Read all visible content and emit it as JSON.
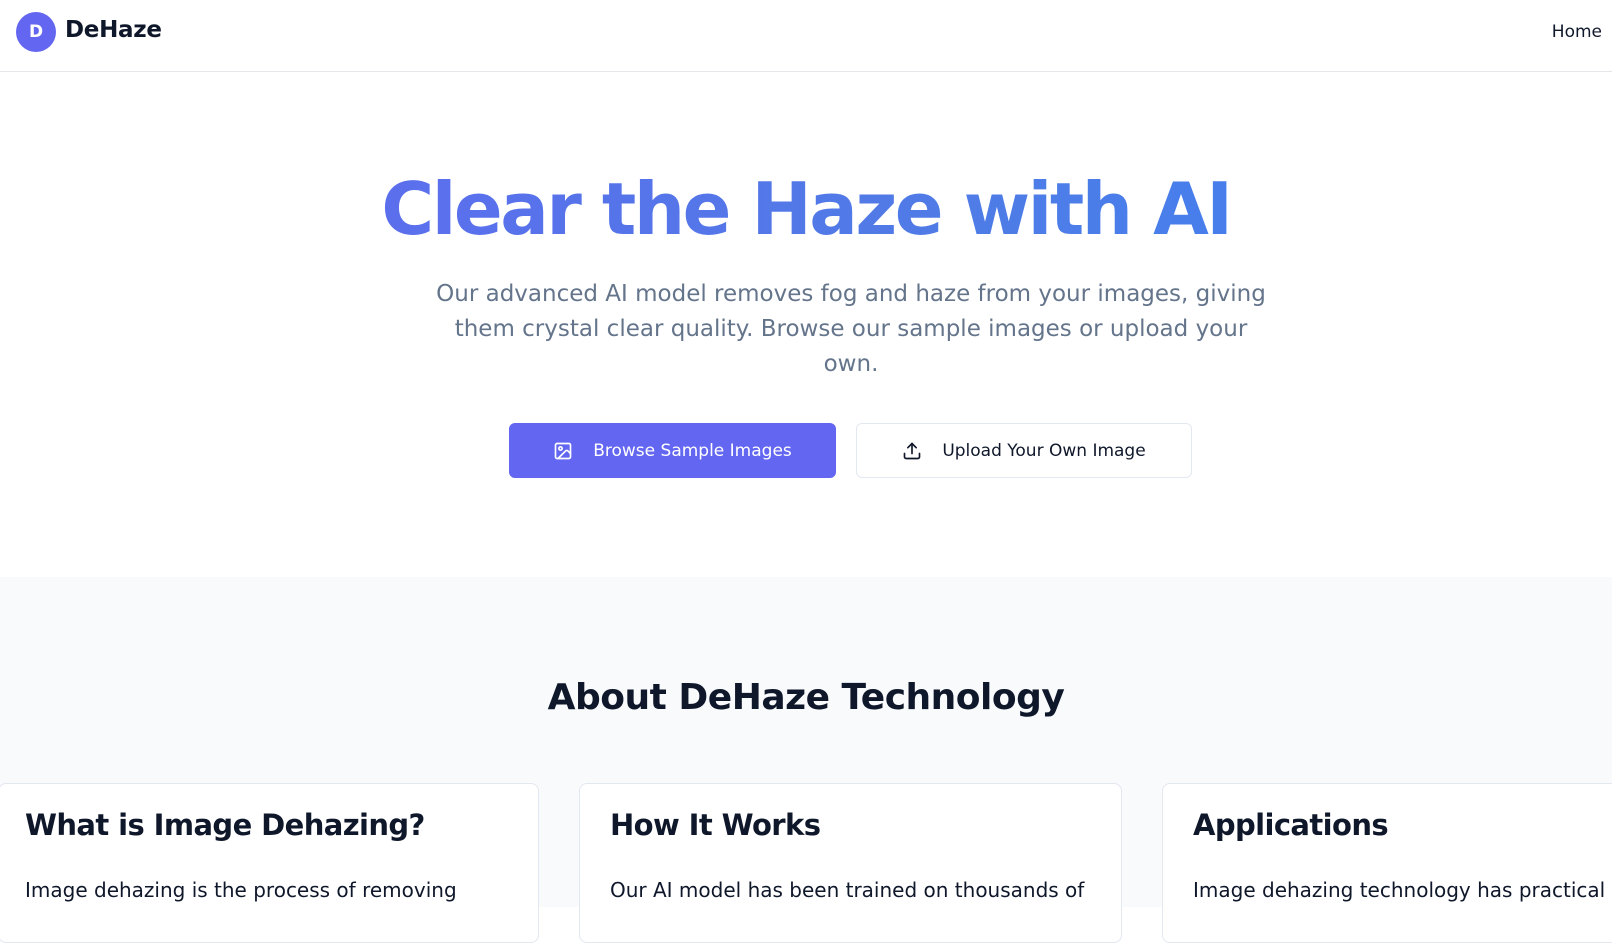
{
  "header": {
    "logo_letter": "D",
    "logo_text": "DeHaze",
    "nav": {
      "home_label": "Home"
    }
  },
  "hero": {
    "title": "Clear the Haze with AI",
    "subtitle": "Our advanced AI model removes fog and haze from your images, giving them crystal clear quality. Browse our sample images or upload your own.",
    "primary_button": {
      "label": "Browse Sample Images",
      "icon": "image-icon"
    },
    "secondary_button": {
      "label": "Upload Your Own Image",
      "icon": "upload-icon"
    }
  },
  "about": {
    "title": "About DeHaze Technology",
    "cards": [
      {
        "title": "What is Image Dehazing?",
        "text": "Image dehazing is the process of removing"
      },
      {
        "title": "How It Works",
        "text": "Our AI model has been trained on thousands of"
      },
      {
        "title": "Applications",
        "text": "Image dehazing technology has practical"
      }
    ]
  },
  "colors": {
    "accent": "#6366f1",
    "title_gradient_end": "#3b82f6",
    "muted_text": "#64748b",
    "section_bg": "#f8fafc",
    "border": "#e2e8f0"
  }
}
